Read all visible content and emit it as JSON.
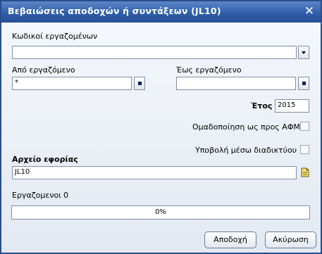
{
  "window": {
    "title": "Βεβαιώσεις αποδοχών ή συντάξεων (JL10)"
  },
  "employee_codes": {
    "label": "Κωδικοί εργαζομένων",
    "value": ""
  },
  "from_employee": {
    "label": "Από εργαζόμενο",
    "value": "*"
  },
  "to_employee": {
    "label": "Έως εργαζόμενο",
    "value": ""
  },
  "year": {
    "label": "Έτος",
    "value": "2015"
  },
  "group_by_afm": {
    "label": "Ομαδοποίηση ως προς ΑΦΜ",
    "checked": false
  },
  "submit_online": {
    "label": "Υποβολή μέσω διαδικτύου",
    "checked": false
  },
  "tax_file": {
    "label": "Αρχείο εφορίας",
    "value": "JL10"
  },
  "employees": {
    "label": "Εργαζομενοι",
    "count": "0"
  },
  "progress": {
    "text": "0%",
    "percent": 0
  },
  "buttons": {
    "accept": "Αποδοχή",
    "cancel": "Ακύρωση"
  },
  "colors": {
    "titlebar": "#2f5ea9",
    "progress_fill": "#3d6fb8"
  }
}
